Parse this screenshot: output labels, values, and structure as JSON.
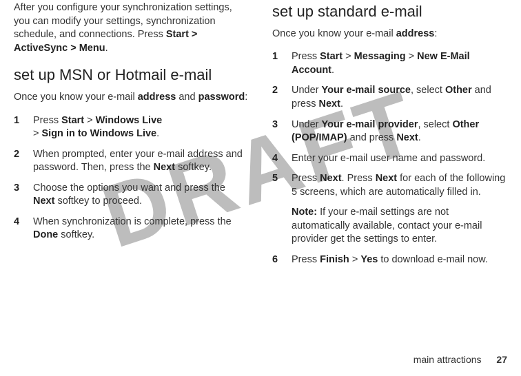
{
  "watermark": "DRAFT",
  "left": {
    "intro_before": "After you configure your synchronization settings, you can modify your settings, synchronization schedule, and connections. Press ",
    "intro_path": "Start > ActiveSync > Menu",
    "intro_after": ".",
    "heading": "set up MSN or Hotmail e-mail",
    "know_before": "Once you know your e-mail ",
    "know_addr": "address",
    "know_mid": " and ",
    "know_pw": "password",
    "know_after": ":",
    "steps": [
      {
        "n": "1",
        "pre": "Press ",
        "p1": "Start",
        "sep1": " > ",
        "p2": "Windows Live",
        "sep2": " > ",
        "p3": "Sign in to Windows Live",
        "post": "."
      },
      {
        "n": "2",
        "pre": "When prompted, enter your e-mail address and password. Then, press the ",
        "ui": "Next",
        "post": " softkey."
      },
      {
        "n": "3",
        "pre": "Choose the options you want and press the ",
        "ui": "Next",
        "post": " softkey to proceed."
      },
      {
        "n": "4",
        "pre": "When synchronization is complete, press the ",
        "ui": "Done",
        "post": " softkey."
      }
    ]
  },
  "right": {
    "heading": "set up standard e-mail",
    "know_before": "Once you know your e-mail ",
    "know_addr": "address",
    "know_after": ":",
    "steps": [
      {
        "n": "1",
        "pre": "Press ",
        "p1": "Start",
        "sep1": " > ",
        "p2": "Messaging",
        "sep2": " > ",
        "p3": "New E-Mail Account",
        "post": "."
      },
      {
        "n": "2",
        "pre": "Under ",
        "ui1": "Your e-mail source",
        "mid1": ", select ",
        "ui2": "Other",
        "mid2": " and press ",
        "ui3": "Next",
        "post": "."
      },
      {
        "n": "3",
        "pre": "Under ",
        "ui1": "Your e-mail provider",
        "mid1": ", select ",
        "ui2": "Other (POP/IMAP)",
        "mid2": " and press ",
        "ui3": "Next",
        "post": "."
      },
      {
        "n": "4",
        "text": "Enter your e-mail user name and password."
      },
      {
        "n": "5",
        "pre": "Press ",
        "ui1": "Next",
        "mid1": ". Press ",
        "ui2": "Next",
        "post": " for each of the following 5 screens, which are automatically filled in."
      },
      {
        "n": "6",
        "pre": "Press ",
        "ui1": "Finish",
        "sep": " > ",
        "ui2": "Yes",
        "post": " to download e-mail now."
      }
    ],
    "note_label": "Note:",
    "note_text": " If your e-mail settings are not automatically available, contact your e-mail provider get the settings to enter."
  },
  "footer": {
    "section": "main attractions",
    "page": "27"
  }
}
